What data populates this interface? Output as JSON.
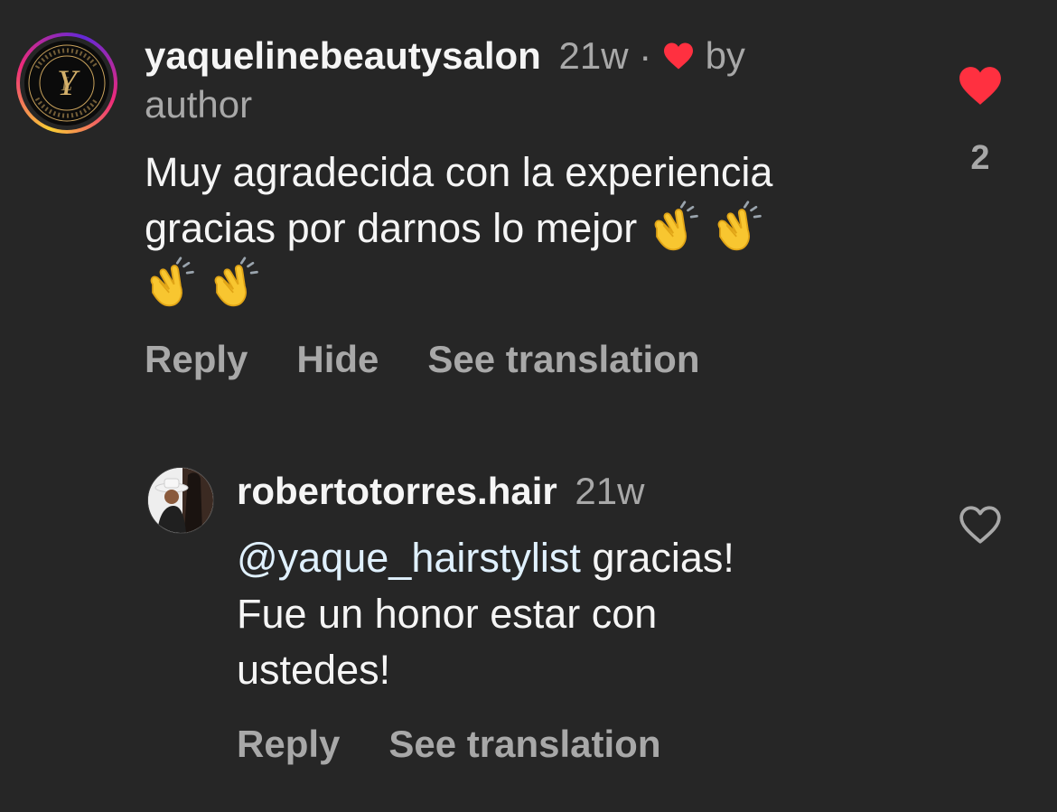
{
  "comment1": {
    "username": "yaquelinebeautysalon",
    "time": "21w",
    "separator": "·",
    "liked_by": "by",
    "liked_by_line2": "author",
    "text_line1": "Muy agradecida con la experiencia",
    "text_line2": "gracias por darnos lo mejor",
    "emoji": "clapping-hands",
    "emoji_count": 4,
    "like_count": "2",
    "actions": {
      "reply": "Reply",
      "hide": "Hide",
      "see_translation": "See translation"
    },
    "avatar_logo_text": "YAQUELINE BEAUTY SALON",
    "avatar_monogram": "Y",
    "liked": true
  },
  "comment2": {
    "username": "robertotorres.hair",
    "time": "21w",
    "mention": "@yaque_hairstylist",
    "text_line1_rest": " gracias!",
    "text_line2": "Fue un honor estar con",
    "text_line3": "ustedes!",
    "actions": {
      "reply": "Reply",
      "see_translation": "See translation"
    },
    "liked": false
  },
  "colors": {
    "background": "#262626",
    "primary_text": "#f5f5f5",
    "secondary_text": "#a8a8a8",
    "like_red": "#ff3040",
    "mention": "#e0f1ff"
  }
}
